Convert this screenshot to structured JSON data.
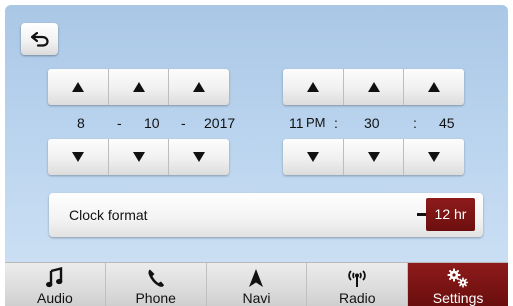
{
  "back_icon": "back-arrow-icon",
  "date": {
    "month": "8",
    "day": "10",
    "year": "2017",
    "separator": "-"
  },
  "time": {
    "hour": "11",
    "ampm": "PM",
    "minute": "30",
    "second": "45",
    "separator": ":"
  },
  "clock_format": {
    "label": "Clock format",
    "value": "12 hr"
  },
  "nav": {
    "items": [
      {
        "label": "Audio",
        "icon": "music-note-icon"
      },
      {
        "label": "Phone",
        "icon": "phone-icon"
      },
      {
        "label": "Navi",
        "icon": "navigation-arrow-icon"
      },
      {
        "label": "Radio",
        "icon": "radio-signal-icon"
      },
      {
        "label": "Settings",
        "icon": "gears-icon",
        "active": true
      }
    ]
  },
  "colors": {
    "accent": "#7a1414",
    "background_top": "#aac7e6",
    "background_bottom": "#cfe3f5"
  }
}
